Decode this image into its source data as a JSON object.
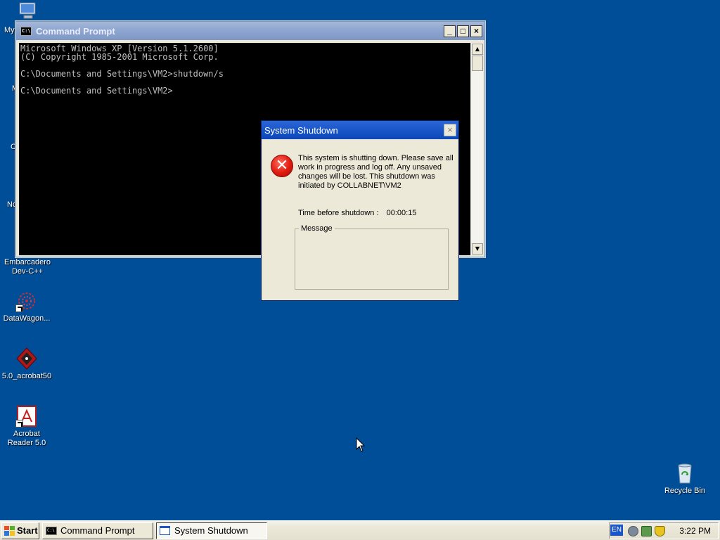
{
  "desktop": {
    "icons": [
      {
        "label": "My"
      },
      {
        "label": "Embarcadero Dev-C++"
      },
      {
        "label": "DataWagon..."
      },
      {
        "label": "5.0_acrobat50"
      },
      {
        "label": "Acrobat Reader 5.0"
      },
      {
        "label": "Recycle Bin"
      }
    ],
    "partial_labels": [
      "M",
      "C",
      "No"
    ]
  },
  "cmd_window": {
    "title": "Command Prompt",
    "icon_text": "C:\\",
    "lines": [
      "Microsoft Windows XP [Version 5.1.2600]",
      "(C) Copyright 1985-2001 Microsoft Corp.",
      "",
      "C:\\Documents and Settings\\VM2>shutdown/s",
      "",
      "C:\\Documents and Settings\\VM2>"
    ],
    "minimize_glyph": "_",
    "maximize_glyph": "□",
    "close_glyph": "×"
  },
  "shutdown_dialog": {
    "title": "System Shutdown",
    "close_glyph": "×",
    "message": "This system is shutting down. Please save all work in progress and log off. Any unsaved changes will be lost. This shutdown was initiated by COLLABNET\\VM2",
    "time_label": "Time before shutdown :",
    "time_value": "00:00:15",
    "message_group_label": "Message",
    "error_glyph": "✕"
  },
  "taskbar": {
    "start_label": "Start",
    "tasks": [
      {
        "label": "Command Prompt",
        "icon_text": "C:\\"
      },
      {
        "label": "System Shutdown"
      }
    ],
    "language": "EN",
    "clock": "3:22 PM"
  },
  "colors": {
    "desktop": "#004e98",
    "active_title": "#1a56c8",
    "inactive_title": "#8ea6d0"
  }
}
